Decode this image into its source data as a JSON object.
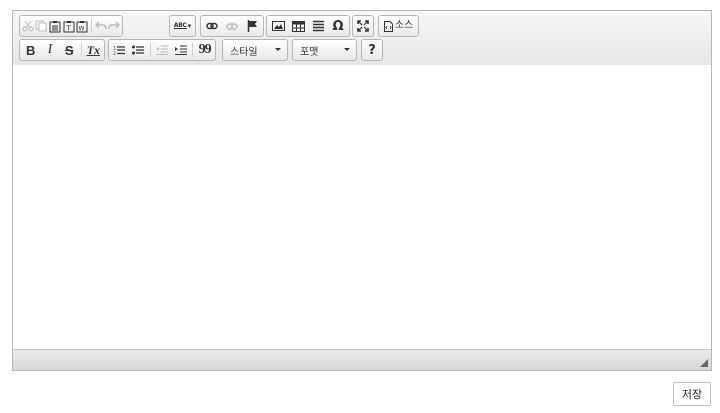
{
  "toolbar": {
    "row1": {
      "clipboard": [
        "cut-icon",
        "copy-icon",
        "paste-icon",
        "paste-text-icon",
        "paste-word-icon"
      ],
      "history": [
        "undo-icon",
        "redo-icon"
      ],
      "spellcheck_label": "ABC",
      "links": [
        "link-icon",
        "unlink-icon",
        "anchor-flag-icon"
      ],
      "insert": [
        "image-icon",
        "table-icon",
        "horizontal-line-icon",
        "special-char-icon"
      ],
      "special_char_glyph": "Ω",
      "maximize_icon": "maximize-icon",
      "source_label": "소스"
    },
    "row2": {
      "bold_label": "B",
      "italic_label": "I",
      "strike_label": "S",
      "remove_format_label": "Tx",
      "lists": [
        "numbered-list-icon",
        "bulleted-list-icon"
      ],
      "indent": [
        "outdent-icon",
        "indent-icon"
      ],
      "blockquote_glyph": "99",
      "style_label": "스타일",
      "format_label": "포맷",
      "help_label": "?"
    }
  },
  "actions": {
    "save_label": "저장"
  },
  "colors": {
    "toolbar_border": "#b6b6b6",
    "disabled_icon": "#bdbdbd",
    "icon": "#333333"
  }
}
